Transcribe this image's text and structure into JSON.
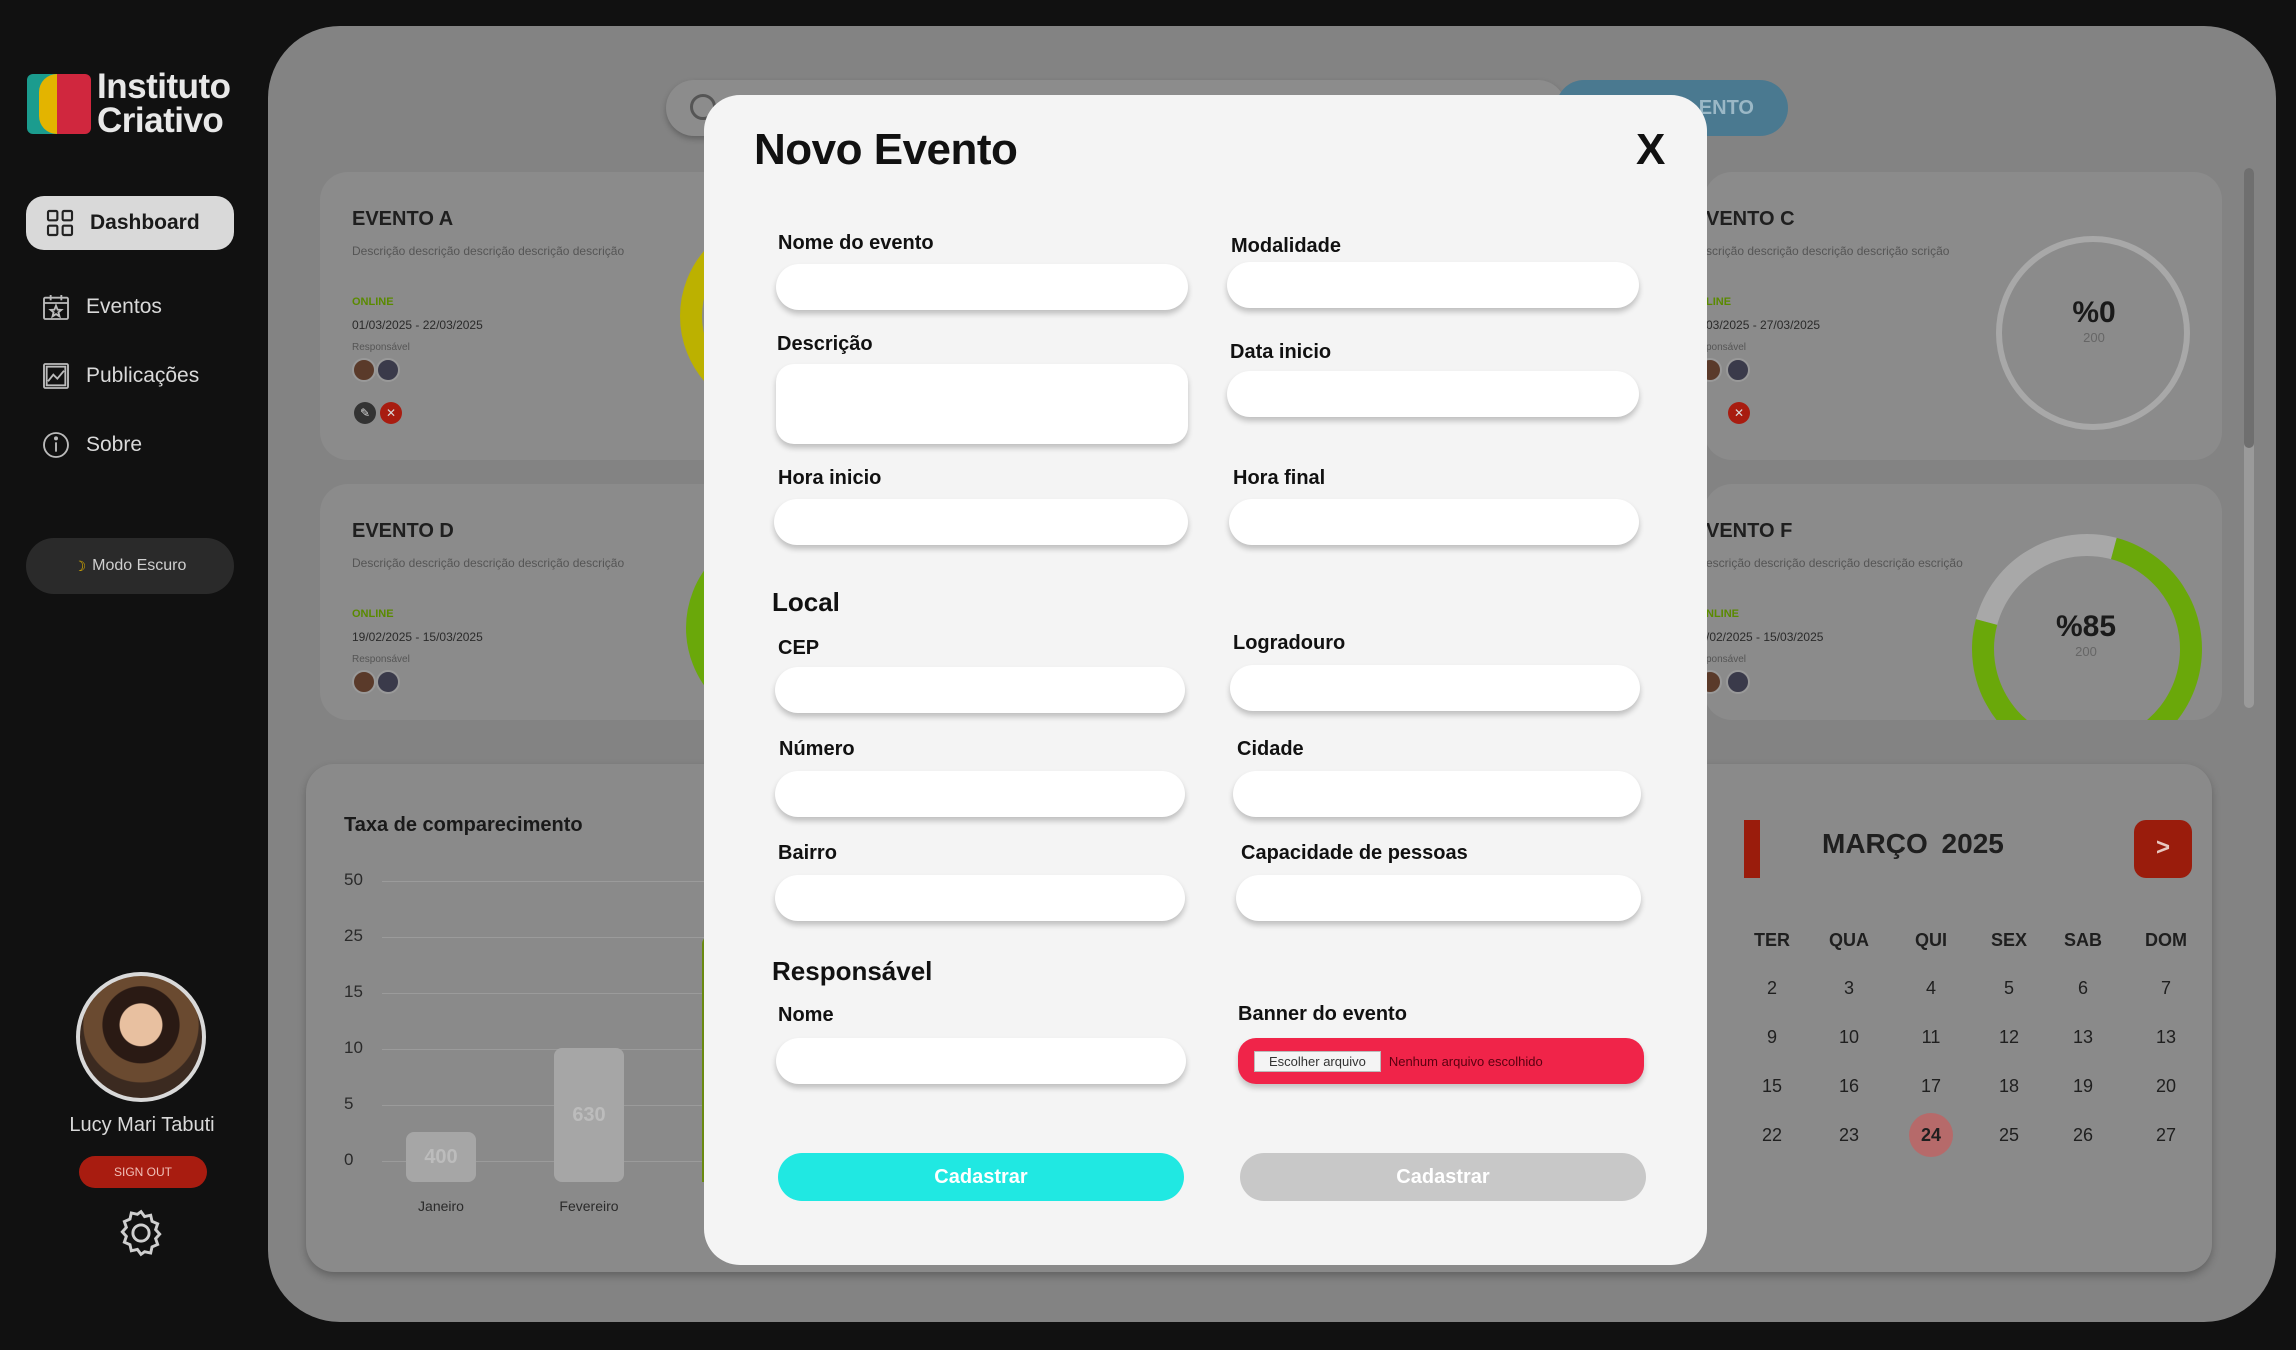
{
  "sidebar": {
    "logo_line1": "Instituto",
    "logo_line2": "Criativo",
    "nav": {
      "dashboard": "Dashboard",
      "eventos": "Eventos",
      "publicacoes": "Publicações",
      "sobre": "Sobre"
    },
    "dark_mode": "Modo Escuro",
    "user_name": "Lucy Mari Tabuti",
    "sign_out": "SIGN OUT"
  },
  "header": {
    "new_event_button": "ENTO"
  },
  "cards": [
    {
      "title": "EVENTO A",
      "desc": "Descrição descrição descrição descrição descrição",
      "status": "ONLINE",
      "dates": "01/03/2025 -  22/03/2025",
      "resp": "Responsável"
    },
    {
      "title": "VENTO C",
      "desc": "scrição descrição descrição descrição scrição",
      "status": "LINE",
      "dates": "03/2025 -  27/03/2025",
      "resp": "ponsável",
      "percent": "%0",
      "count": "200"
    },
    {
      "title": "EVENTO D",
      "desc": "Descrição descrição descrição descrição descrição",
      "status": "ONLINE",
      "dates": "19/02/2025 -  15/03/2025",
      "resp": "Responsável"
    },
    {
      "title": "VENTO F",
      "desc": "escrição descrição descrição descrição escrição",
      "status": "NLINE",
      "dates": "/02/2025 -  15/03/2025",
      "resp": "ponsável",
      "percent": "%85",
      "count": "200"
    }
  ],
  "chart_data": {
    "type": "bar",
    "title": "Taxa de comparecimento",
    "yticks": [
      "50",
      "25",
      "15",
      "10",
      "5",
      "0"
    ],
    "categories": [
      "Janeiro",
      "Fevereiro"
    ],
    "values": [
      400,
      630
    ],
    "value_labels": [
      "400",
      "630"
    ]
  },
  "calendar": {
    "title": "MARÇO  2025",
    "next": ">",
    "weekdays": [
      "TER",
      "QUA",
      "QUI",
      "SEX",
      "SAB",
      "DOM"
    ],
    "rows": [
      [
        "2",
        "3",
        "4",
        "5",
        "6",
        "7"
      ],
      [
        "9",
        "10",
        "11",
        "12",
        "13",
        "13"
      ],
      [
        "15",
        "16",
        "17",
        "18",
        "19",
        "20"
      ],
      [
        "22",
        "23",
        "24",
        "25",
        "26",
        "27"
      ]
    ],
    "today": "24"
  },
  "modal": {
    "title": "Novo Evento",
    "close": "X",
    "labels": {
      "nome_evento": "Nome do evento",
      "modalidade": "Modalidade",
      "descricao": "Descrição",
      "data_inicio": "Data inicio",
      "hora_inicio": "Hora inicio",
      "hora_final": "Hora final",
      "local": "Local",
      "cep": "CEP",
      "logradouro": "Logradouro",
      "numero": "Número",
      "cidade": "Cidade",
      "bairro": "Bairro",
      "capacidade": "Capacidade de pessoas",
      "responsavel": "Responsável",
      "nome": "Nome",
      "banner": "Banner do evento"
    },
    "file_button": "Escolher arquivo",
    "file_none": "Nenhum arquivo escolhido",
    "submit_primary": "Cadastrar",
    "submit_secondary": "Cadastrar"
  },
  "colors": {
    "accent_cyan": "#20e8e2",
    "file_red": "#f02449",
    "sign_out_red": "#a81c10",
    "ring_yellow": "#bcb100",
    "ring_green": "#6aa80a"
  }
}
